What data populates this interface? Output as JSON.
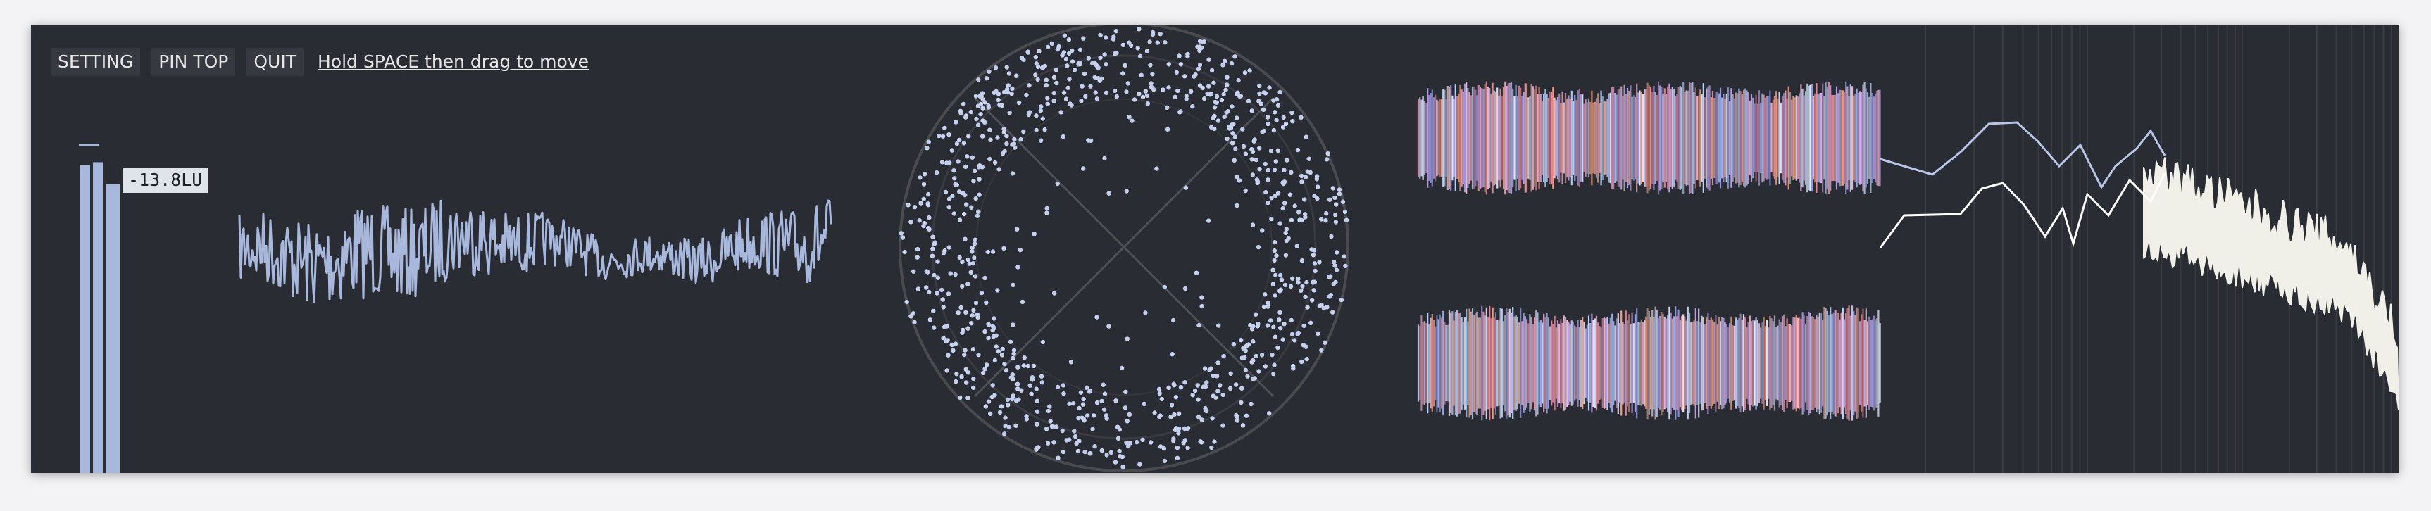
{
  "toolbar": {
    "setting_label": "SETTING",
    "pin_top_label": "PIN TOP",
    "quit_label": "QUIT",
    "hint": "Hold SPACE then drag to move"
  },
  "meter": {
    "lufs_label": "-13.8LU",
    "bar_levels": [
      0.98,
      0.99,
      0.92
    ],
    "peak_hold_level": 1.0
  },
  "colors": {
    "window_bg": "#2a2c33",
    "accent": "#a8b8dc",
    "spectrum_fill": "#f0f0e8",
    "goniometer_grid": "#4a4b4f",
    "spectrum_grid": "#3a3c42"
  },
  "waveform": {
    "style": "line",
    "color": "#a8b8dc"
  },
  "goniometer": {
    "style": "scatter",
    "ring": true
  },
  "spectrogram": {
    "channels": [
      "left",
      "right"
    ],
    "palette": [
      "#c9a8f5",
      "#9aa8ff",
      "#f48a9e",
      "#f3b3d0",
      "#b8d8ff",
      "#e6e6ff",
      "#f5a07a"
    ]
  },
  "spectrum": {
    "upper_curve_color": "#b8c6e8",
    "lower_curve_color": "#ffffff"
  }
}
